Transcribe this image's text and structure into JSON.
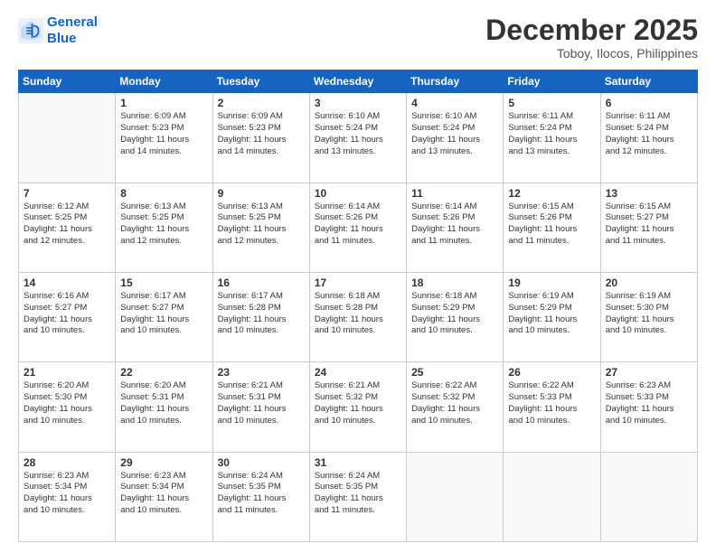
{
  "logo": {
    "line1": "General",
    "line2": "Blue"
  },
  "title": "December 2025",
  "location": "Toboy, Ilocos, Philippines",
  "days_header": [
    "Sunday",
    "Monday",
    "Tuesday",
    "Wednesday",
    "Thursday",
    "Friday",
    "Saturday"
  ],
  "weeks": [
    [
      {
        "day": "",
        "info": ""
      },
      {
        "day": "1",
        "info": "Sunrise: 6:09 AM\nSunset: 5:23 PM\nDaylight: 11 hours\nand 14 minutes."
      },
      {
        "day": "2",
        "info": "Sunrise: 6:09 AM\nSunset: 5:23 PM\nDaylight: 11 hours\nand 14 minutes."
      },
      {
        "day": "3",
        "info": "Sunrise: 6:10 AM\nSunset: 5:24 PM\nDaylight: 11 hours\nand 13 minutes."
      },
      {
        "day": "4",
        "info": "Sunrise: 6:10 AM\nSunset: 5:24 PM\nDaylight: 11 hours\nand 13 minutes."
      },
      {
        "day": "5",
        "info": "Sunrise: 6:11 AM\nSunset: 5:24 PM\nDaylight: 11 hours\nand 13 minutes."
      },
      {
        "day": "6",
        "info": "Sunrise: 6:11 AM\nSunset: 5:24 PM\nDaylight: 11 hours\nand 12 minutes."
      }
    ],
    [
      {
        "day": "7",
        "info": "Sunrise: 6:12 AM\nSunset: 5:25 PM\nDaylight: 11 hours\nand 12 minutes."
      },
      {
        "day": "8",
        "info": "Sunrise: 6:13 AM\nSunset: 5:25 PM\nDaylight: 11 hours\nand 12 minutes."
      },
      {
        "day": "9",
        "info": "Sunrise: 6:13 AM\nSunset: 5:25 PM\nDaylight: 11 hours\nand 12 minutes."
      },
      {
        "day": "10",
        "info": "Sunrise: 6:14 AM\nSunset: 5:26 PM\nDaylight: 11 hours\nand 11 minutes."
      },
      {
        "day": "11",
        "info": "Sunrise: 6:14 AM\nSunset: 5:26 PM\nDaylight: 11 hours\nand 11 minutes."
      },
      {
        "day": "12",
        "info": "Sunrise: 6:15 AM\nSunset: 5:26 PM\nDaylight: 11 hours\nand 11 minutes."
      },
      {
        "day": "13",
        "info": "Sunrise: 6:15 AM\nSunset: 5:27 PM\nDaylight: 11 hours\nand 11 minutes."
      }
    ],
    [
      {
        "day": "14",
        "info": "Sunrise: 6:16 AM\nSunset: 5:27 PM\nDaylight: 11 hours\nand 10 minutes."
      },
      {
        "day": "15",
        "info": "Sunrise: 6:17 AM\nSunset: 5:27 PM\nDaylight: 11 hours\nand 10 minutes."
      },
      {
        "day": "16",
        "info": "Sunrise: 6:17 AM\nSunset: 5:28 PM\nDaylight: 11 hours\nand 10 minutes."
      },
      {
        "day": "17",
        "info": "Sunrise: 6:18 AM\nSunset: 5:28 PM\nDaylight: 11 hours\nand 10 minutes."
      },
      {
        "day": "18",
        "info": "Sunrise: 6:18 AM\nSunset: 5:29 PM\nDaylight: 11 hours\nand 10 minutes."
      },
      {
        "day": "19",
        "info": "Sunrise: 6:19 AM\nSunset: 5:29 PM\nDaylight: 11 hours\nand 10 minutes."
      },
      {
        "day": "20",
        "info": "Sunrise: 6:19 AM\nSunset: 5:30 PM\nDaylight: 11 hours\nand 10 minutes."
      }
    ],
    [
      {
        "day": "21",
        "info": "Sunrise: 6:20 AM\nSunset: 5:30 PM\nDaylight: 11 hours\nand 10 minutes."
      },
      {
        "day": "22",
        "info": "Sunrise: 6:20 AM\nSunset: 5:31 PM\nDaylight: 11 hours\nand 10 minutes."
      },
      {
        "day": "23",
        "info": "Sunrise: 6:21 AM\nSunset: 5:31 PM\nDaylight: 11 hours\nand 10 minutes."
      },
      {
        "day": "24",
        "info": "Sunrise: 6:21 AM\nSunset: 5:32 PM\nDaylight: 11 hours\nand 10 minutes."
      },
      {
        "day": "25",
        "info": "Sunrise: 6:22 AM\nSunset: 5:32 PM\nDaylight: 11 hours\nand 10 minutes."
      },
      {
        "day": "26",
        "info": "Sunrise: 6:22 AM\nSunset: 5:33 PM\nDaylight: 11 hours\nand 10 minutes."
      },
      {
        "day": "27",
        "info": "Sunrise: 6:23 AM\nSunset: 5:33 PM\nDaylight: 11 hours\nand 10 minutes."
      }
    ],
    [
      {
        "day": "28",
        "info": "Sunrise: 6:23 AM\nSunset: 5:34 PM\nDaylight: 11 hours\nand 10 minutes."
      },
      {
        "day": "29",
        "info": "Sunrise: 6:23 AM\nSunset: 5:34 PM\nDaylight: 11 hours\nand 10 minutes."
      },
      {
        "day": "30",
        "info": "Sunrise: 6:24 AM\nSunset: 5:35 PM\nDaylight: 11 hours\nand 11 minutes."
      },
      {
        "day": "31",
        "info": "Sunrise: 6:24 AM\nSunset: 5:35 PM\nDaylight: 11 hours\nand 11 minutes."
      },
      {
        "day": "",
        "info": ""
      },
      {
        "day": "",
        "info": ""
      },
      {
        "day": "",
        "info": ""
      }
    ]
  ]
}
